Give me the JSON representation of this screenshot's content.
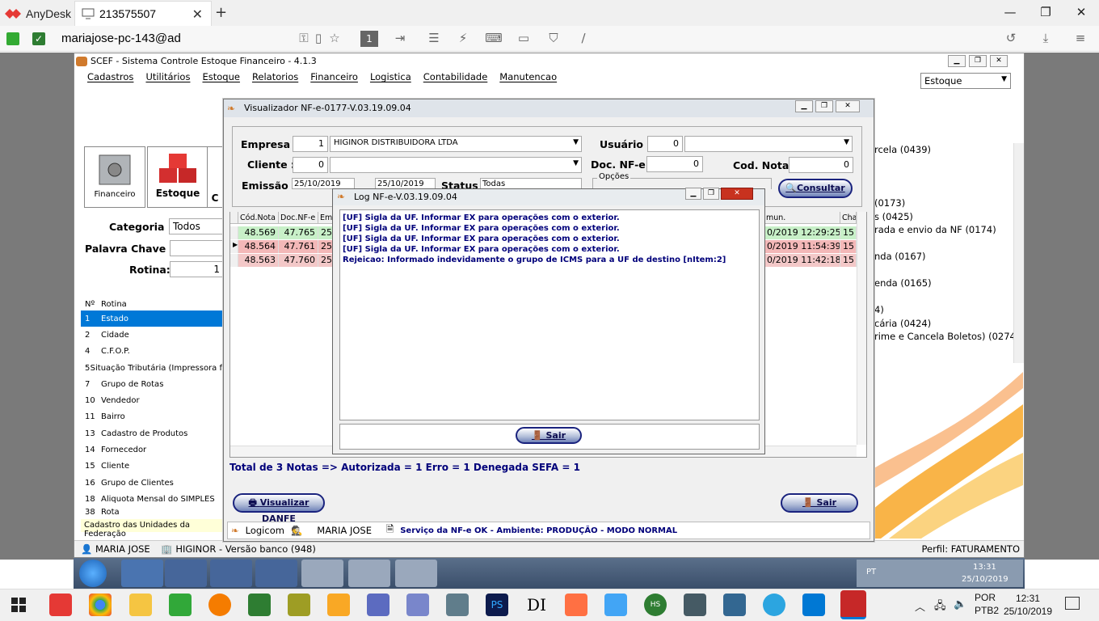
{
  "anydesk": {
    "app_name": "AnyDesk",
    "tab_label": "213575507",
    "address": "mariajose-pc-143@ad",
    "badge": "1"
  },
  "scef": {
    "title": "SCEF - Sistema Controle Estoque Financeiro - 4.1.3",
    "menu": [
      "Cadastros",
      "Utilitários",
      "Estoque",
      "Relatorios",
      "Financeiro",
      "Logistica",
      "Contabilidade",
      "Manutencao"
    ],
    "module_select": "Estoque",
    "big_buttons": [
      "Financeiro",
      "Estoque",
      "C"
    ],
    "categoria_label": "Categoria :",
    "categoria_value": "Todos",
    "palavra_label": "Palavra Chave :",
    "rotina_label": "Rotina:",
    "rotina_value": "1",
    "list_headers": [
      "Nº",
      "Rotina"
    ],
    "list_rows": [
      [
        "1",
        "Estado"
      ],
      [
        "2",
        "Cidade"
      ],
      [
        "4",
        "C.F.O.P."
      ],
      [
        "5",
        "Situação Tributária (Impressora f"
      ],
      [
        "7",
        "Grupo de Rotas"
      ],
      [
        "10",
        "Vendedor"
      ],
      [
        "11",
        "Bairro"
      ],
      [
        "13",
        "Cadastro de Produtos"
      ],
      [
        "14",
        "Fornecedor"
      ],
      [
        "15",
        "Cliente"
      ],
      [
        "16",
        "Grupo de Clientes"
      ],
      [
        "18",
        "Aliquota Mensal do SIMPLES"
      ],
      [
        "38",
        "Rota"
      ]
    ],
    "list_status": "Cadastro das Unidades da Federação",
    "right_items": [
      "rcela (0439)",
      "",
      "",
      "",
      "(0173)",
      "s (0425)",
      "rada e envio da NF (0174)",
      "",
      "nda (0167)",
      "",
      "enda (0165)",
      "",
      "4)",
      "cária (0424)",
      "rime e Cancela Boletos) (0274)"
    ],
    "status_user": "MARIA JOSE",
    "status_company": "HIGINOR - Versão banco (948)",
    "status_profile": "Perfil: FATURAMENTO"
  },
  "nfe": {
    "title": "Visualizador NF-e-0177-V.03.19.09.04",
    "empresa_label": "Empresa :",
    "empresa_code": "1",
    "empresa_name": "HIGINOR DISTRIBUIDORA LTDA",
    "usuario_label": "Usuário :",
    "usuario_code": "0",
    "cliente_label": "Cliente :",
    "cliente_code": "0",
    "docnfe_label": "Doc. NF-e :",
    "docnfe_value": "0",
    "codnota_label": "Cod. Nota :",
    "codnota_value": "0",
    "emissao_label": "Emissão :",
    "emissao_from": "25/10/2019",
    "emissao_to": "25/10/2019",
    "status_label": "Status :",
    "status_value": "Todas",
    "opcoes_label": "Opções",
    "consultar": "Consultar",
    "grid_headers": [
      "Cód.Nota",
      "Doc.NF-e",
      "Em",
      "mun.",
      "Cha"
    ],
    "grid_rows": [
      [
        "48.569",
        "47.765",
        "25",
        "0/2019 12:29:25",
        "15"
      ],
      [
        "48.564",
        "47.761",
        "25",
        "0/2019 11:54:39",
        "15"
      ],
      [
        "48.563",
        "47.760",
        "25",
        "0/2019 11:42:18",
        "15"
      ]
    ],
    "total": "Total de 3 Notas => Autorizada = 1 Erro = 1 Denegada SEFA = 1",
    "visualizar": "Visualizar DANFE",
    "sair": "Sair",
    "status_logicom": "Logicom",
    "status_user": "MARIA JOSE",
    "status_service": "Serviço da NF-e OK - Ambiente: PRODUÇÃO - MODO NORMAL"
  },
  "log": {
    "title": "Log NF-e-V.03.19.09.04",
    "lines": [
      "[UF] Sigla da UF. Informar EX para operações com o exterior.",
      "[UF] Sigla da UF. Informar EX para operações com o exterior.",
      "[UF] Sigla da UF. Informar EX para operações com o exterior.",
      "[UF] Sigla da UF. Informar EX para operações com o exterior.",
      "Rejeicao: Informado indevidamente o grupo de ICMS para a UF de destino [nItem:2]"
    ],
    "sair": "Sair"
  },
  "remote_tray": {
    "lang": "PT",
    "time": "13:31",
    "date": "25/10/2019"
  },
  "host_tray": {
    "lang1": "POR",
    "lang2": "PTB2",
    "time": "12:31",
    "date": "25/10/2019"
  },
  "host_apps": [
    "PS",
    "DI",
    "HS"
  ]
}
